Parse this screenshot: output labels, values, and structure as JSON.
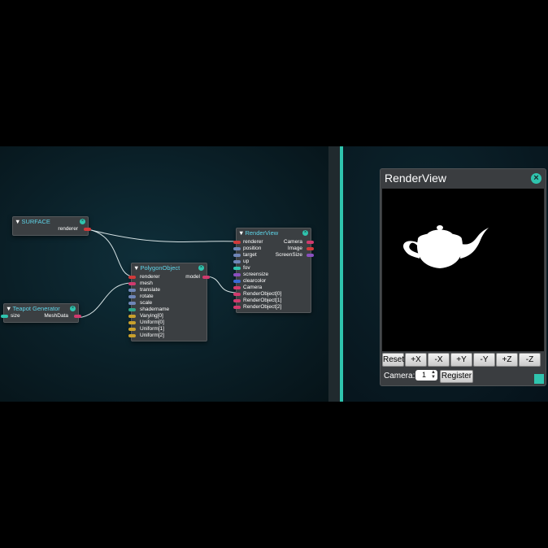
{
  "nodes": {
    "surface": {
      "title": "SURFACE",
      "outputs": [
        "renderer"
      ]
    },
    "teapot": {
      "title": "Teapot Generator",
      "inputs": [
        "size"
      ],
      "outputs": [
        "MeshData"
      ]
    },
    "polygon": {
      "title": "PolygonObject",
      "inputs": [
        "renderer",
        "mesh",
        "translate",
        "rotate",
        "scale",
        "shadername",
        "Varying[0]",
        "Uniform[0]",
        "Uniform[1]",
        "Uniform[2]"
      ],
      "outputs": [
        "model"
      ]
    },
    "renderview": {
      "title": "RenderView",
      "inputs": [
        "renderer",
        "position",
        "target",
        "up",
        "fov",
        "screensize",
        "clearcolor",
        "Camera",
        "RenderObject[0]",
        "RenderObject[1]",
        "RenderObject[2]"
      ],
      "outputs": [
        "Camera",
        "Image",
        "ScreenSize"
      ]
    }
  },
  "render_panel": {
    "title": "RenderView",
    "buttons": [
      "Reset",
      "+X",
      "-X",
      "+Y",
      "-Y",
      "+Z",
      "-Z"
    ],
    "camera_label": "Camera:",
    "camera_value": "1",
    "register_label": "Register"
  },
  "colors": {
    "accent": "#2fc4ae",
    "node_bg": "#3b3f42",
    "title": "#5ed4e8"
  },
  "icons": {
    "collapse": "triangle-down-icon",
    "close": "close-icon"
  }
}
